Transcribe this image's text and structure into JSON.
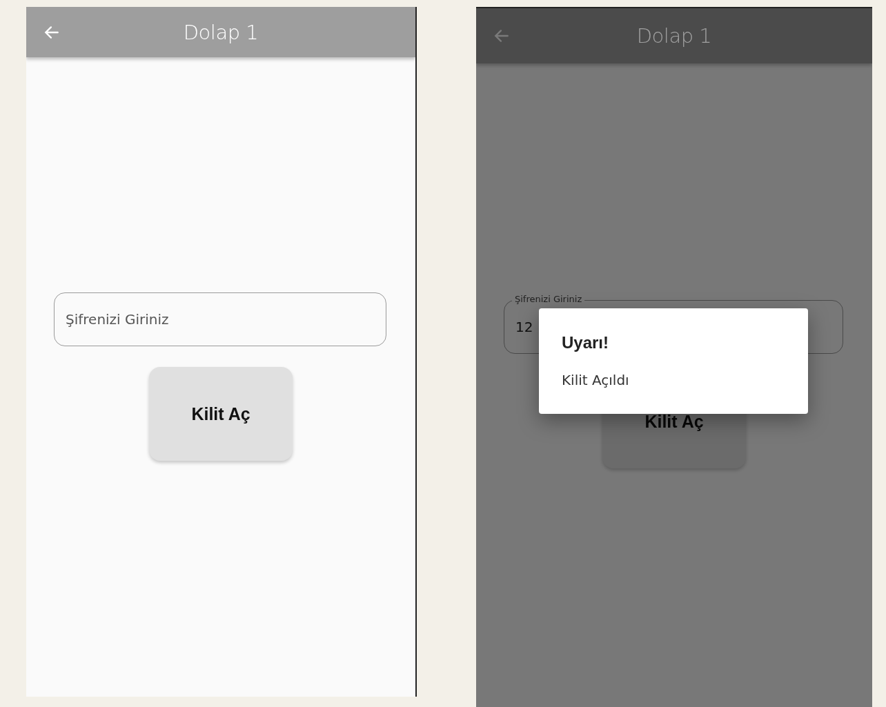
{
  "screens": [
    {
      "title": "Dolap 1",
      "field": {
        "placeholder": "Şifrenizi Giriniz"
      },
      "button": "Kilit Aç"
    },
    {
      "title": "Dolap 1",
      "field": {
        "label": "Şifrenizi Giriniz",
        "value": "12"
      },
      "button": "Kilit Aç",
      "dialog": {
        "title": "Uyarı!",
        "message": "Kilit Açıldı"
      }
    }
  ]
}
